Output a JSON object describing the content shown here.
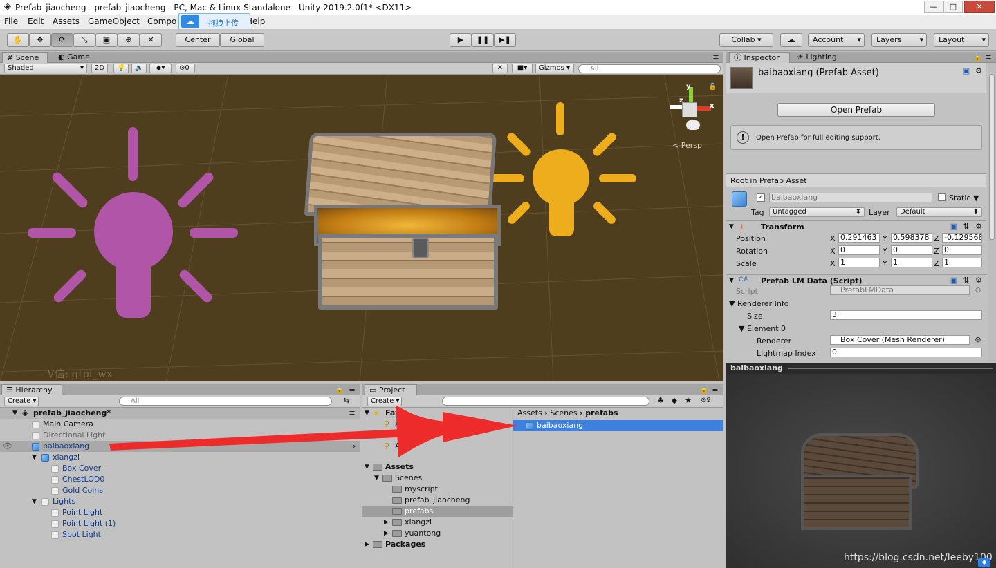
{
  "window": {
    "title": "Prefab_jiaocheng - prefab_jiaocheng - PC, Mac & Linux Standalone - Unity 2019.2.0f1* <DX11>",
    "minimize": "—",
    "restore": "□",
    "close": "✕"
  },
  "overlay": {
    "label": "拖拽上传"
  },
  "menu": [
    "File",
    "Edit",
    "Assets",
    "GameObject",
    "Compo",
    "Help"
  ],
  "toolbar": {
    "center": "Center",
    "global": "Global",
    "collab": "Collab",
    "account": "Account",
    "layers": "Layers",
    "layout": "Layout"
  },
  "scene": {
    "tabs": [
      "Scene",
      "Game"
    ],
    "shaded": "Shaded",
    "mode2d": "2D",
    "fx_count": "0",
    "gizmos": "Gizmos",
    "search": "All",
    "persp": "Persp",
    "watermark": "V信: qtpl_wx",
    "axes": {
      "x": "x",
      "y": "y",
      "z": "z"
    },
    "light_colors": {
      "point": "#b055a8",
      "spot": "#eead1d"
    }
  },
  "hierarchy": {
    "tab": "Hierarchy",
    "create": "Create",
    "search": "All",
    "items": [
      {
        "label": "prefab_jiaocheng*"
      },
      {
        "label": "Main Camera"
      },
      {
        "label": "Directional Light"
      },
      {
        "label": "baibaoxiang"
      },
      {
        "label": "xiangzi"
      },
      {
        "label": "Box Cover"
      },
      {
        "label": "ChestLOD0"
      },
      {
        "label": "Gold Coins"
      },
      {
        "label": "Lights"
      },
      {
        "label": "Point Light"
      },
      {
        "label": "Point Light (1)"
      },
      {
        "label": "Spot Light"
      }
    ]
  },
  "project": {
    "tab": "Project",
    "create": "Create",
    "favorites": "Fav",
    "fav_items": [
      "All Ma",
      "All Mo",
      "All P"
    ],
    "count": "9",
    "tree": [
      "Assets",
      "Scenes",
      "myscript",
      "prefab_jiaocheng",
      "prefabs",
      "xiangzi",
      "yuantong",
      "Packages"
    ],
    "breadcrumb": [
      "Assets",
      "Scenes",
      "prefabs"
    ],
    "file": "baibaoxiang"
  },
  "inspector": {
    "tabs": [
      "Inspector",
      "Lighting"
    ],
    "asset_title": "baibaoxiang (Prefab Asset)",
    "open_prefab": "Open Prefab",
    "info": "Open Prefab for full editing support.",
    "root_label": "Root in Prefab Asset",
    "name": "baibaoxiang",
    "static": "Static",
    "tag_label": "Tag",
    "tag": "Untagged",
    "layer_label": "Layer",
    "layer": "Default",
    "transform": {
      "title": "Transform",
      "position": {
        "label": "Position",
        "x": "0.291463",
        "y": "0.598378",
        "z": "-0.129568"
      },
      "rotation": {
        "label": "Rotation",
        "x": "0",
        "y": "0",
        "z": "0"
      },
      "scale": {
        "label": "Scale",
        "x": "1",
        "y": "1",
        "z": "1"
      }
    },
    "script_comp": {
      "title": "Prefab LM Data (Script)",
      "script_label": "Script",
      "script": "PrefabLMData",
      "renderer_info": "Renderer Info",
      "size_label": "Size",
      "size": "3",
      "element": "Element 0",
      "renderer_label": "Renderer",
      "renderer": "Box Cover (Mesh Renderer)",
      "lightmap_label": "Lightmap Index",
      "lightmap": "0"
    },
    "preview_title": "baibaoxiang",
    "watermark": "https://blog.csdn.net/leeby100"
  }
}
